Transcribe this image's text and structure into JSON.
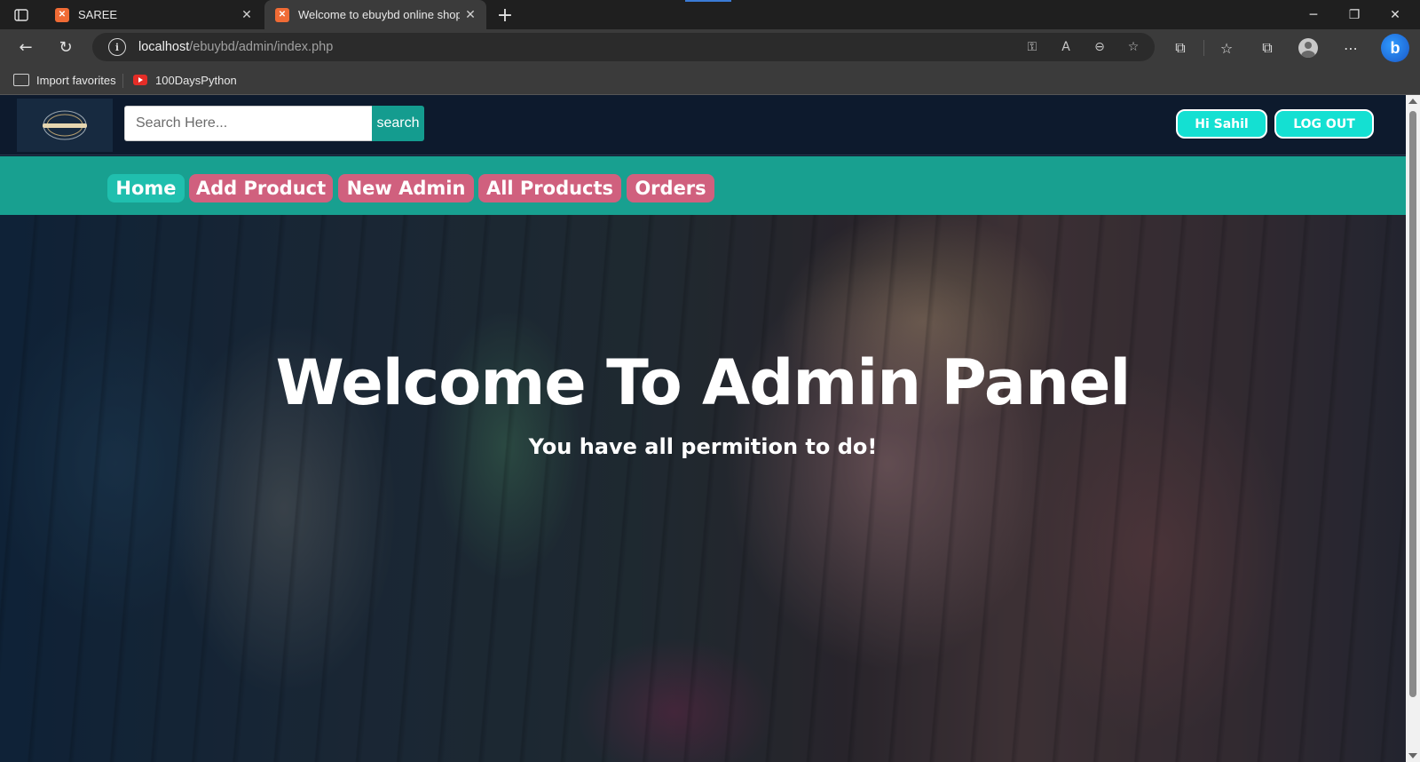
{
  "browser": {
    "tabs": [
      {
        "title": "SAREE",
        "active": false,
        "favicon": "xampp-icon"
      },
      {
        "title": "Welcome to ebuybd online shop",
        "active": true,
        "favicon": "xampp-icon"
      }
    ],
    "url": {
      "host": "localhost",
      "path": "/ebuybd/admin/index.php"
    },
    "bookmarks": [
      {
        "label": "Import favorites",
        "icon": "import-favorites-icon"
      },
      {
        "label": "100DaysPython",
        "icon": "youtube-icon"
      }
    ]
  },
  "header": {
    "search_placeholder": "Search Here...",
    "search_button": "search",
    "greeting": "Hi Sahil",
    "logout": "LOG OUT"
  },
  "nav": {
    "items": [
      {
        "label": "Home",
        "active": true
      },
      {
        "label": "Add Product",
        "active": false
      },
      {
        "label": "New Admin",
        "active": false
      },
      {
        "label": "All Products",
        "active": false
      },
      {
        "label": "Orders",
        "active": false
      }
    ]
  },
  "hero": {
    "title": "Welcome To Admin Panel",
    "subtitle": "You have all permition to do!"
  },
  "colors": {
    "header_bg": "#0d1a2d",
    "nav_bg": "#18a090",
    "nav_item": "#d0607e",
    "nav_active": "#20bfae",
    "accent_button": "#14e0d2"
  }
}
